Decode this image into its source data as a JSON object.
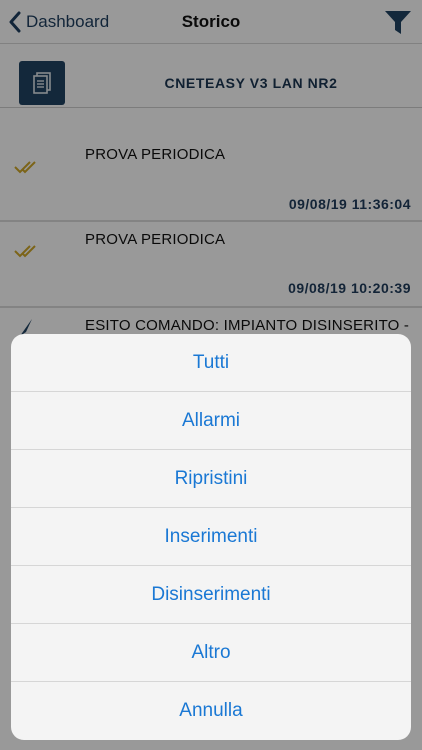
{
  "navbar": {
    "back_label": "Dashboard",
    "title": "Storico"
  },
  "device": {
    "name": "CNETEASY V3 LAN NR2"
  },
  "events": [
    {
      "title": "PROVA PERIODICA",
      "timestamp": "09/08/19 11:36:04"
    },
    {
      "title": "PROVA PERIODICA",
      "timestamp": "09/08/19 10:20:39"
    },
    {
      "title": "ESITO COMANDO: IMPIANTO DISINSERITO -"
    }
  ],
  "action_sheet": {
    "options": [
      "Tutti",
      "Allarmi",
      "Ripristini",
      "Inserimenti",
      "Disinserimenti",
      "Altro"
    ],
    "cancel_label": "Annulla"
  },
  "colors": {
    "brand_dark": "#1f4160",
    "accent_blue": "#1a78d4",
    "check_gold": "#c9a227"
  }
}
